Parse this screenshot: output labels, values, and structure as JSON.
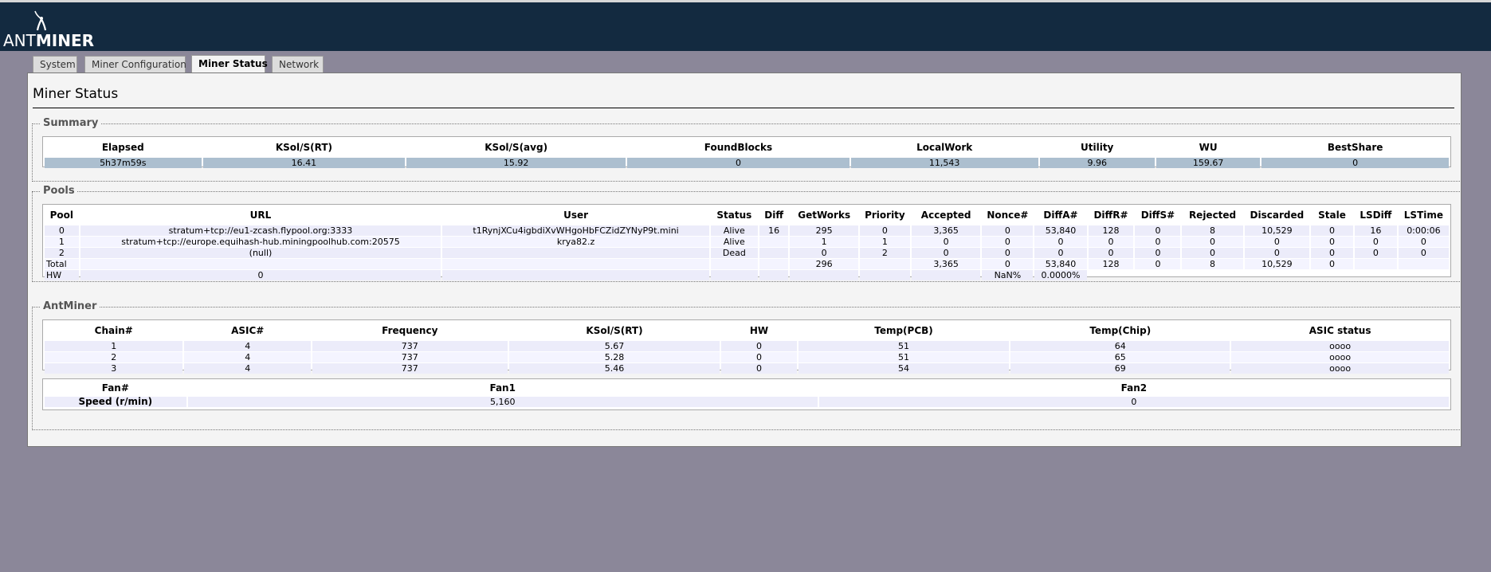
{
  "logo": {
    "part1": "ANT",
    "part2": "MINER"
  },
  "tabs": [
    {
      "label": "System"
    },
    {
      "label": "Miner Configuration"
    },
    {
      "label": "Miner Status",
      "active": true
    },
    {
      "label": "Network"
    }
  ],
  "page_title": "Miner Status",
  "summary": {
    "legend": "Summary",
    "headers": [
      "Elapsed",
      "KSol/S(RT)",
      "KSol/S(avg)",
      "FoundBlocks",
      "LocalWork",
      "Utility",
      "WU",
      "BestShare"
    ],
    "values": [
      "5h37m59s",
      "16.41",
      "15.92",
      "0",
      "11,543",
      "9.96",
      "159.67",
      "0"
    ]
  },
  "pools": {
    "legend": "Pools",
    "headers": [
      "Pool",
      "URL",
      "User",
      "Status",
      "Diff",
      "GetWorks",
      "Priority",
      "Accepted",
      "Nonce#",
      "DiffA#",
      "DiffR#",
      "DiffS#",
      "Rejected",
      "Discarded",
      "Stale",
      "LSDiff",
      "LSTime"
    ],
    "rows": [
      [
        "0",
        "stratum+tcp://eu1-zcash.flypool.org:3333",
        "t1RynjXCu4igbdiXvWHgoHbFCZidZYNyP9t.mini",
        "Alive",
        "16",
        "295",
        "0",
        "3,365",
        "0",
        "53,840",
        "128",
        "0",
        "8",
        "10,529",
        "0",
        "16",
        "0:00:06"
      ],
      [
        "1",
        "stratum+tcp://europe.equihash-hub.miningpoolhub.com:20575",
        "krya82.z",
        "Alive",
        "",
        "1",
        "1",
        "0",
        "0",
        "0",
        "0",
        "0",
        "0",
        "0",
        "0",
        "0",
        "0"
      ],
      [
        "2",
        "(null)",
        "",
        "Dead",
        "",
        "0",
        "2",
        "0",
        "0",
        "0",
        "0",
        "0",
        "0",
        "0",
        "0",
        "0",
        "0"
      ],
      [
        "Total",
        "",
        "",
        "",
        "",
        "296",
        "",
        "3,365",
        "0",
        "53,840",
        "128",
        "0",
        "8",
        "10,529",
        "0",
        "",
        ""
      ]
    ],
    "hw_row": {
      "label": "HW",
      "value": "0",
      "nonce": "NaN%",
      "diffa": "0.0000%"
    }
  },
  "antminer": {
    "legend": "AntMiner",
    "headers": [
      "Chain#",
      "ASIC#",
      "Frequency",
      "KSol/S(RT)",
      "HW",
      "Temp(PCB)",
      "Temp(Chip)",
      "ASIC status"
    ],
    "rows": [
      [
        "1",
        "4",
        "737",
        "5.67",
        "0",
        "51",
        "64",
        "oooo"
      ],
      [
        "2",
        "4",
        "737",
        "5.28",
        "0",
        "51",
        "65",
        "oooo"
      ],
      [
        "3",
        "4",
        "737",
        "5.46",
        "0",
        "54",
        "69",
        "oooo"
      ]
    ],
    "fans": {
      "headers": [
        "Fan#",
        "Fan1",
        "Fan2"
      ],
      "speed_label": "Speed (r/min)",
      "values": [
        "5,160",
        "0"
      ]
    }
  }
}
